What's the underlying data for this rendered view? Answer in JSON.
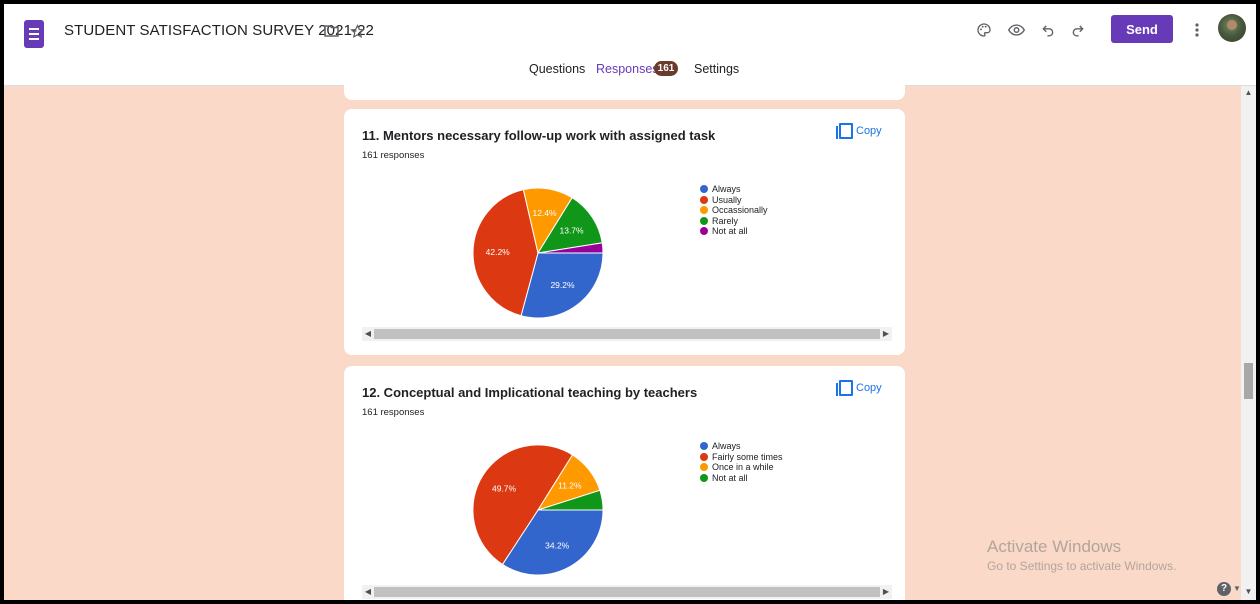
{
  "app": {
    "title": "STUDENT SATISFACTION SURVEY 2021-22",
    "send_label": "Send"
  },
  "icons": {
    "folder": "folder-icon",
    "star": "star-icon",
    "palette": "palette-icon",
    "preview": "eye-icon",
    "undo": "undo-icon",
    "redo": "redo-icon",
    "more": "more-vert-icon"
  },
  "tabs": [
    {
      "label": "Questions",
      "active": false
    },
    {
      "label": "Responses",
      "active": true
    },
    {
      "label": "Settings",
      "active": false
    }
  ],
  "responses_count": "161",
  "accent_color": "#673ab7",
  "page_background": "#fad9c8",
  "copy_label": "Copy",
  "questions": [
    {
      "title": "11. Mentors necessary follow-up work with assigned task",
      "responses": "161 responses",
      "chart_data": {
        "type": "pie",
        "categories": [
          "Always",
          "Usually",
          "Occassionally",
          "Rarely",
          "Not at all"
        ],
        "values": [
          29.2,
          42.2,
          12.4,
          13.7,
          2.5
        ],
        "labels": [
          "29.2%",
          "42.2%",
          "12.4%",
          "13.7%",
          ""
        ],
        "colors": [
          "#3366cc",
          "#dc3912",
          "#ff9900",
          "#109618",
          "#990099"
        ],
        "legend": "right"
      }
    },
    {
      "title": "12. Conceptual and Implicational teaching by teachers",
      "responses": "161 responses",
      "chart_data": {
        "type": "pie",
        "categories": [
          "Always",
          "Fairly some times",
          "Once in a while",
          "Not at all"
        ],
        "values": [
          34.2,
          49.7,
          11.2,
          4.9
        ],
        "labels": [
          "34.2%",
          "49.7%",
          "11.2%",
          ""
        ],
        "colors": [
          "#3366cc",
          "#dc3912",
          "#ff9900",
          "#109618"
        ],
        "legend": "right"
      }
    }
  ],
  "watermark": {
    "line1": "Activate Windows",
    "line2": "Go to Settings to activate Windows."
  },
  "help_label": "?"
}
